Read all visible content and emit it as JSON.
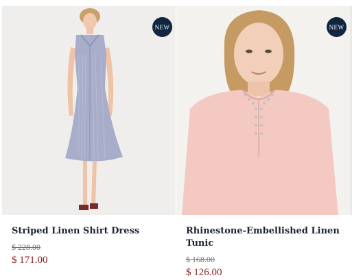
{
  "products": [
    {
      "badge": "NEW",
      "title": "Striped Linen Shirt Dress",
      "original_price": "$ 228.00",
      "sale_price": "$ 171.00",
      "image_icon": "product-photo-striped-dress"
    },
    {
      "badge": "NEW",
      "title": "Rhinestone-Embellished Linen Tunic",
      "original_price": "$ 168.00",
      "sale_price": "$ 126.00",
      "image_icon": "product-photo-pink-tunic"
    }
  ],
  "colors": {
    "badge_bg": "#0f2540",
    "title_text": "#1c2333",
    "sale_price": "#8a1c1f",
    "original_price": "#6f6f6f"
  }
}
